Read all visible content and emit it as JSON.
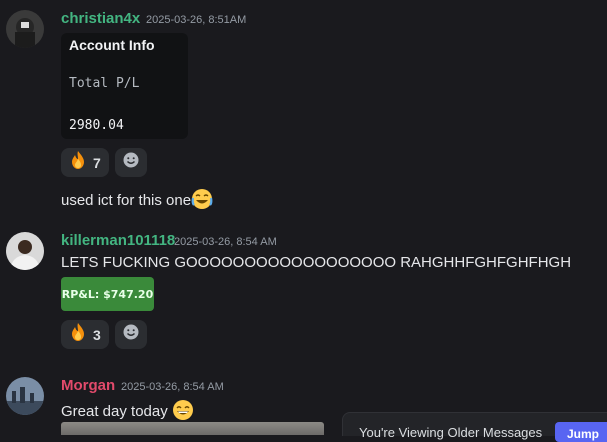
{
  "messages": [
    {
      "username": "christian4x",
      "username_color": "#43b581",
      "timestamp": "2025-03-26, 8:51AM",
      "embed": {
        "title": "Account Info",
        "label": "Total P/L",
        "value": "2980.04"
      },
      "reactions": [
        {
          "icon": "fire-icon",
          "count": "7"
        }
      ],
      "followup_text": "used ict for this one",
      "followup_emoji": "joy-emoji"
    },
    {
      "username": "killerman101118",
      "username_color": "#43b581",
      "timestamp": "2025-03-26, 8:54 AM",
      "text": "LETS FUCKING GOOOOOOOOOOOOOOOOOO RAHGHHFGHFGHFHGH",
      "badge": "RP&L: $747.20",
      "reactions": [
        {
          "icon": "fire-icon",
          "count": "3"
        }
      ]
    },
    {
      "username": "Morgan",
      "username_color": "#e24a6b",
      "timestamp": "2025-03-26, 8:54 AM",
      "text": "Great day today",
      "emoji": "grin-emoji"
    }
  ],
  "banner": {
    "text": "You're Viewing Older Messages",
    "jump_label": "Jump"
  }
}
